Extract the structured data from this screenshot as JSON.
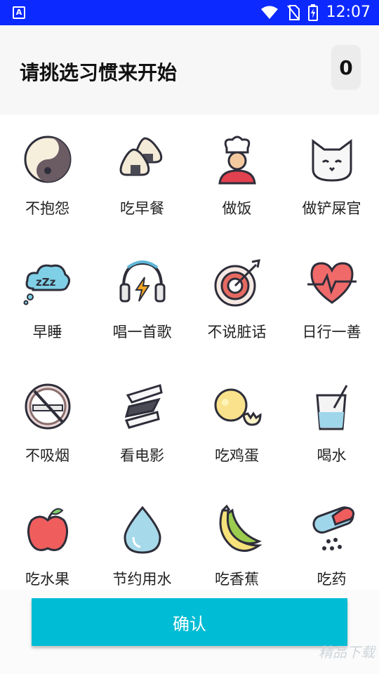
{
  "status": {
    "time": "12:07"
  },
  "header": {
    "title": "请挑选习惯来开始",
    "count": "0"
  },
  "habits": [
    {
      "label": "不抱怨",
      "icon": "yin-yang-icon"
    },
    {
      "label": "吃早餐",
      "icon": "onigiri-icon"
    },
    {
      "label": "做饭",
      "icon": "chef-icon"
    },
    {
      "label": "做铲屎官",
      "icon": "cat-icon"
    },
    {
      "label": "早睡",
      "icon": "sleep-cloud-icon"
    },
    {
      "label": "唱一首歌",
      "icon": "headphones-icon"
    },
    {
      "label": "不说脏话",
      "icon": "target-icon"
    },
    {
      "label": "日行一善",
      "icon": "heartbeat-icon"
    },
    {
      "label": "不吸烟",
      "icon": "no-smoking-icon"
    },
    {
      "label": "看电影",
      "icon": "film-reel-icon"
    },
    {
      "label": "吃鸡蛋",
      "icon": "egg-icon"
    },
    {
      "label": "喝水",
      "icon": "water-glass-icon"
    },
    {
      "label": "吃水果",
      "icon": "apple-icon"
    },
    {
      "label": "节约用水",
      "icon": "water-drop-icon"
    },
    {
      "label": "吃香蕉",
      "icon": "banana-icon"
    },
    {
      "label": "吃药",
      "icon": "pill-icon"
    }
  ],
  "confirm_label": "确认",
  "watermark": "精品下载",
  "colors": {
    "status_bar": "#0c29ff",
    "accent": "#00bcd4"
  }
}
